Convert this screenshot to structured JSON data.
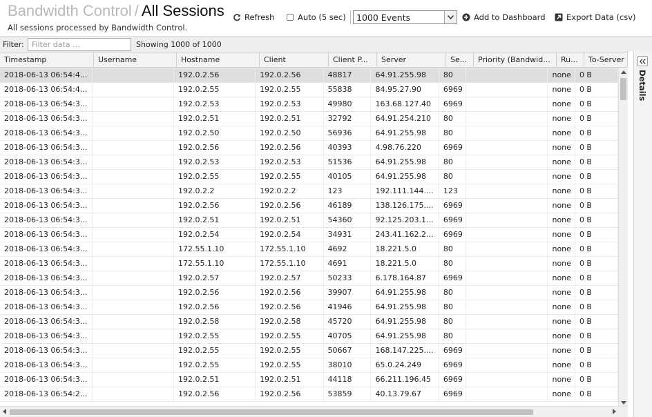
{
  "header": {
    "app_title": "Bandwidth Control",
    "separator": "/",
    "page_title": "All Sessions",
    "subtitle": "All sessions processed by Bandwidth Control."
  },
  "toolbar": {
    "refresh_label": "Refresh",
    "auto_label": "Auto (5 sec)",
    "events_selected": "1000 Events",
    "add_dashboard_label": "Add to Dashboard",
    "export_label": "Export Data (csv)"
  },
  "filter": {
    "label": "Filter:",
    "placeholder": "Filter data ...",
    "showing": "Showing 1000 of 1000"
  },
  "table": {
    "columns": [
      "Timestamp",
      "Username",
      "Hostname",
      "Client",
      "Client P...",
      "Server",
      "Se...",
      "Priority (Bandwid...",
      "Ru...",
      "To-Server"
    ],
    "rows": [
      [
        "2018-06-13 06:54:4...",
        "",
        "192.0.2.56",
        "192.0.2.56",
        "48817",
        "64.91.255.98",
        "80",
        "",
        "none",
        "0 B"
      ],
      [
        "2018-06-13 06:54:4...",
        "",
        "192.0.2.55",
        "192.0.2.55",
        "55838",
        "84.95.27.90",
        "6969",
        "",
        "none",
        "0 B"
      ],
      [
        "2018-06-13 06:54:3...",
        "",
        "192.0.2.53",
        "192.0.2.53",
        "49980",
        "163.68.127.40",
        "6969",
        "",
        "none",
        "0 B"
      ],
      [
        "2018-06-13 06:54:3...",
        "",
        "192.0.2.51",
        "192.0.2.51",
        "32792",
        "64.91.254.210",
        "80",
        "",
        "none",
        "0 B"
      ],
      [
        "2018-06-13 06:54:3...",
        "",
        "192.0.2.50",
        "192.0.2.50",
        "56936",
        "64.91.255.98",
        "80",
        "",
        "none",
        "0 B"
      ],
      [
        "2018-06-13 06:54:3...",
        "",
        "192.0.2.56",
        "192.0.2.56",
        "40393",
        "4.98.76.220",
        "6969",
        "",
        "none",
        "0 B"
      ],
      [
        "2018-06-13 06:54:3...",
        "",
        "192.0.2.53",
        "192.0.2.53",
        "51536",
        "64.91.255.98",
        "80",
        "",
        "none",
        "0 B"
      ],
      [
        "2018-06-13 06:54:3...",
        "",
        "192.0.2.55",
        "192.0.2.55",
        "40105",
        "64.91.255.98",
        "80",
        "",
        "none",
        "0 B"
      ],
      [
        "2018-06-13 06:54:3...",
        "",
        "192.0.2.2",
        "192.0.2.2",
        "123",
        "192.111.144....",
        "123",
        "",
        "none",
        "0 B"
      ],
      [
        "2018-06-13 06:54:3...",
        "",
        "192.0.2.56",
        "192.0.2.56",
        "46189",
        "138.126.175....",
        "6969",
        "",
        "none",
        "0 B"
      ],
      [
        "2018-06-13 06:54:3...",
        "",
        "192.0.2.51",
        "192.0.2.51",
        "54360",
        "92.125.203.1...",
        "6969",
        "",
        "none",
        "0 B"
      ],
      [
        "2018-06-13 06:54:3...",
        "",
        "192.0.2.54",
        "192.0.2.54",
        "34931",
        "243.41.162.2...",
        "6969",
        "",
        "none",
        "0 B"
      ],
      [
        "2018-06-13 06:54:3...",
        "",
        "172.55.1.10",
        "172.55.1.10",
        "4692",
        "18.221.5.0",
        "80",
        "",
        "none",
        "0 B"
      ],
      [
        "2018-06-13 06:54:3...",
        "",
        "172.55.1.10",
        "172.55.1.10",
        "4691",
        "18.221.5.0",
        "80",
        "",
        "none",
        "0 B"
      ],
      [
        "2018-06-13 06:54:3...",
        "",
        "192.0.2.57",
        "192.0.2.57",
        "50233",
        "6.178.164.87",
        "6969",
        "",
        "none",
        "0 B"
      ],
      [
        "2018-06-13 06:54:3...",
        "",
        "192.0.2.56",
        "192.0.2.56",
        "39907",
        "64.91.255.98",
        "80",
        "",
        "none",
        "0 B"
      ],
      [
        "2018-06-13 06:54:3...",
        "",
        "192.0.2.56",
        "192.0.2.56",
        "41946",
        "64.91.255.98",
        "80",
        "",
        "none",
        "0 B"
      ],
      [
        "2018-06-13 06:54:3...",
        "",
        "192.0.2.58",
        "192.0.2.58",
        "45720",
        "64.91.255.98",
        "80",
        "",
        "none",
        "0 B"
      ],
      [
        "2018-06-13 06:54:3...",
        "",
        "192.0.2.55",
        "192.0.2.55",
        "40705",
        "64.91.255.98",
        "80",
        "",
        "none",
        "0 B"
      ],
      [
        "2018-06-13 06:54:3...",
        "",
        "192.0.2.55",
        "192.0.2.55",
        "50667",
        "168.147.225....",
        "6969",
        "",
        "none",
        "0 B"
      ],
      [
        "2018-06-13 06:54:3...",
        "",
        "192.0.2.55",
        "192.0.2.55",
        "38010",
        "65.0.24.249",
        "6969",
        "",
        "none",
        "0 B"
      ],
      [
        "2018-06-13 06:54:3...",
        "",
        "192.0.2.51",
        "192.0.2.51",
        "44118",
        "66.211.196.45",
        "6969",
        "",
        "none",
        "0 B"
      ],
      [
        "2018-06-13 06:54:2...",
        "",
        "192.0.2.56",
        "192.0.2.56",
        "53859",
        "40.13.79.67",
        "6969",
        "",
        "none",
        "0 B"
      ]
    ],
    "selected_row": 0
  },
  "details_panel": {
    "label": "Details"
  },
  "icons": {
    "refresh": "refresh-icon",
    "add": "plus-circle-icon",
    "export": "export-icon",
    "dropdown": "chevron-down-icon",
    "collapse": "double-chevron-left-icon"
  }
}
